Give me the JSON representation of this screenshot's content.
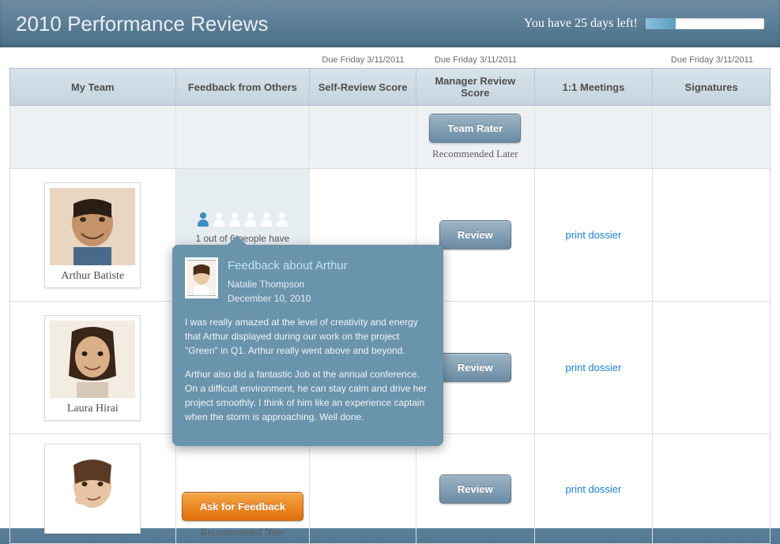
{
  "header": {
    "title": "2010 Performance Reviews",
    "days_left_text": "You have 25 days left!"
  },
  "due_labels": {
    "self_review": "Due  Friday 3/11/2011",
    "manager_review": "Due Friday 3/11/2011",
    "signatures": "Due Friday 3/11/2011"
  },
  "columns": {
    "my_team": "My Team",
    "feedback": "Feedback from Others",
    "self_score": "Self-Review Score",
    "manager_score": "Manager Review Score",
    "meetings": "1:1 Meetings",
    "signatures": "Signatures"
  },
  "subheader": {
    "team_rater_label": "Team Rater",
    "recommended_later": "Recommended Later"
  },
  "rows": [
    {
      "name": "Arthur Batiste",
      "feedback_summary": "1 out of 6 people have provided feedback",
      "filled_icons": 1,
      "total_icons": 6,
      "review_label": "Review",
      "print_label": "print dossier",
      "avatar_bg": "linear-gradient(135deg,#d6b18e,#8a5a3b)"
    },
    {
      "name": "Laura Hirai",
      "review_label": "Review",
      "print_label": "print dossier",
      "avatar_bg": "linear-gradient(135deg,#e8c9a0,#b27d4e)"
    },
    {
      "name": "",
      "ask_label": "Ask for Feedback",
      "recommended_now": "Recommended Now",
      "review_label": "Review",
      "print_label": "print dossier",
      "avatar_bg": "linear-gradient(135deg,#f1d5b8,#c98d5f)"
    }
  ],
  "popup": {
    "title": "Feedback about Arthur",
    "author": "Natalie Thompson",
    "date": "December 10, 2010",
    "para1": "I was really amazed at the level of creativity and energy that Arthur displayed during our work on the project \"Green\" in Q1. Arthur really went above and beyond.",
    "para2": "Arthur also did a fantastic Job at the annual conference. On a difficult environment, he can stay calm and drive her project smoothly. I think of him like an experience captain when the storm is approaching. Well done."
  }
}
